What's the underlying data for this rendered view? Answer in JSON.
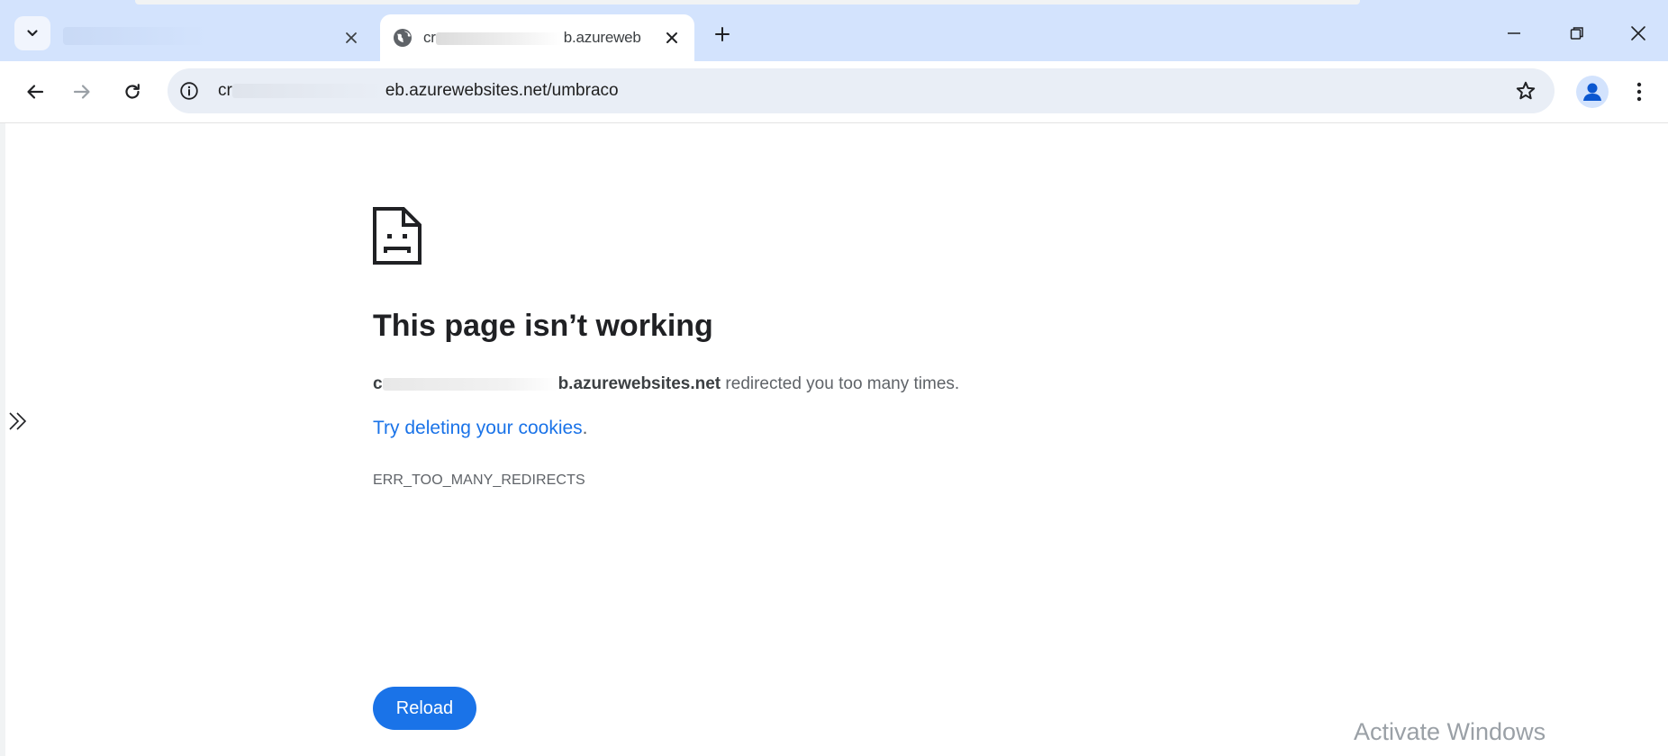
{
  "browser": {
    "tabs": [
      {
        "title": "",
        "active": false
      },
      {
        "title_visible_start": "cr",
        "title_visible_end": "b.azureweb",
        "active": true,
        "favicon": "globe-icon"
      }
    ],
    "tab_search_icon": "chevron-down-icon",
    "new_tab_icon": "plus-icon",
    "window_controls": [
      "minimize-icon",
      "restore-icon",
      "close-icon"
    ]
  },
  "toolbar": {
    "back_icon": "arrow-left-icon",
    "forward_icon": "arrow-right-icon",
    "reload_icon": "reload-icon",
    "site_info_icon": "info-icon",
    "url_visible_start": "cr",
    "url_visible_end": "eb.azurewebsites.net/umbraco",
    "bookmark_icon": "star-outline-icon",
    "profile_icon": "person-icon",
    "menu_icon": "kebab-menu-icon"
  },
  "error_page": {
    "icon": "sad-page-icon",
    "title": "This page isn’t working",
    "host_visible": "b.azurewebsites.net",
    "host_visible_start": "c",
    "message_suffix": " redirected you too many times.",
    "suggestion_link": "Try deleting your cookies",
    "suggestion_period": ".",
    "error_code": "ERR_TOO_MANY_REDIRECTS",
    "reload_label": "Reload"
  },
  "side_panel_toggle_icon": "double-chevron-right-icon",
  "watermark": "Activate Windows",
  "colors": {
    "tabstrip": "#d3e3fd",
    "omnibox": "#e9eef6",
    "accent": "#1a73e8",
    "title_text": "#202124",
    "secondary_text": "#5f6368"
  }
}
